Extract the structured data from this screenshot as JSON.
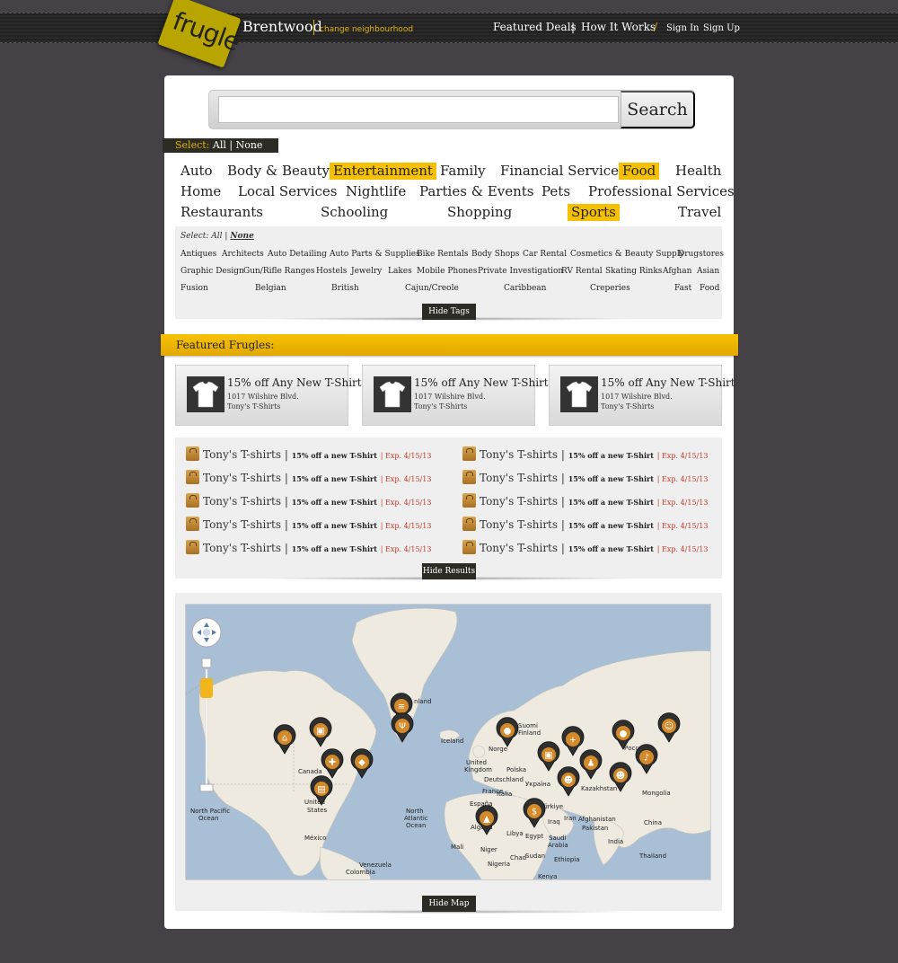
{
  "header": {
    "logo": "frugle",
    "location": "Brentwood",
    "change_link": "change neighbourhood",
    "nav": {
      "featured": "Featured Deals",
      "how": "How It Works",
      "signin": "Sign In",
      "signup": "Sign Up"
    },
    "sep1": "|",
    "sep2": "/"
  },
  "search": {
    "placeholder": "",
    "button": "Search"
  },
  "category_select": {
    "label": "Select:",
    "all": "All",
    "divider": "|",
    "none": "None"
  },
  "categories": [
    {
      "label": "Auto",
      "selected": false
    },
    {
      "label": "Body & Beauty",
      "selected": false
    },
    {
      "label": "Entertainment",
      "selected": true
    },
    {
      "label": "Family",
      "selected": false
    },
    {
      "label": "Financial Services",
      "selected": false
    },
    {
      "label": "Food",
      "selected": true
    },
    {
      "label": "Health",
      "selected": false
    },
    {
      "label": "Home",
      "selected": false
    },
    {
      "label": "Local Services",
      "selected": false
    },
    {
      "label": "Nightlife",
      "selected": false
    },
    {
      "label": "Parties & Events",
      "selected": false
    },
    {
      "label": "Pets",
      "selected": false
    },
    {
      "label": "Professional Services",
      "selected": false
    },
    {
      "label": "Restaurants",
      "selected": false
    },
    {
      "label": "Schooling",
      "selected": false
    },
    {
      "label": "Shopping",
      "selected": false
    },
    {
      "label": "Sports",
      "selected": true
    },
    {
      "label": "Travel",
      "selected": false
    }
  ],
  "tags": {
    "select_label": "Select:",
    "all": "All",
    "none": "None",
    "items": [
      "Antiques",
      "Architects",
      "Auto Detailing",
      "Auto Parts & Supplies",
      "Bike Rentals",
      "Body Shops",
      "Car Rental",
      "Cosmetics & Beauty Supply",
      "Drugstores",
      "Graphic Design",
      "Gun/Rifle Ranges",
      "Hostels",
      "Jewelry",
      "Lakes",
      "Mobile Phones",
      "Private Investigation",
      "RV Rental",
      "Skating Rinks",
      "Afghan",
      "Asian",
      "Fusion",
      "Belgian",
      "British",
      "Cajun/Creole",
      "Caribbean",
      "Creperies",
      "Fast",
      "Food"
    ],
    "hide_button": "Hide Tags"
  },
  "featured": {
    "title": "Featured Frugles:",
    "deals": [
      {
        "title": "15% off Any New T-Shirt",
        "address": "1017 Wilshire Blvd.",
        "merchant": "Tony's T-Shirts"
      },
      {
        "title": "15% off Any New T-Shirt",
        "address": "1017 Wilshire Blvd.",
        "merchant": "Tony's T-Shirts"
      },
      {
        "title": "15% off Any New T-Shirt",
        "address": "1017 Wilshire Blvd.",
        "merchant": "Tony's T-Shirts"
      }
    ]
  },
  "results": {
    "items": [
      {
        "merchant": "Tony's T-shirts",
        "offer": "15% off a new T-Shirt",
        "expires": "Exp. 4/15/13"
      },
      {
        "merchant": "Tony's T-shirts",
        "offer": "15% off a new T-Shirt",
        "expires": "Exp. 4/15/13"
      },
      {
        "merchant": "Tony's T-shirts",
        "offer": "15% off a new T-Shirt",
        "expires": "Exp. 4/15/13"
      },
      {
        "merchant": "Tony's T-shirts",
        "offer": "15% off a new T-Shirt",
        "expires": "Exp. 4/15/13"
      },
      {
        "merchant": "Tony's T-shirts",
        "offer": "15% off a new T-Shirt",
        "expires": "Exp. 4/15/13"
      },
      {
        "merchant": "Tony's T-shirts",
        "offer": "15% off a new T-Shirt",
        "expires": "Exp. 4/15/13"
      },
      {
        "merchant": "Tony's T-shirts",
        "offer": "15% off a new T-Shirt",
        "expires": "Exp. 4/15/13"
      },
      {
        "merchant": "Tony's T-shirts",
        "offer": "15% off a new T-Shirt",
        "expires": "Exp. 4/15/13"
      },
      {
        "merchant": "Tony's T-shirts",
        "offer": "15% off a new T-Shirt",
        "expires": "Exp. 4/15/13"
      },
      {
        "merchant": "Tony's T-shirts",
        "offer": "15% off a new T-Shirt",
        "expires": "Exp. 4/15/13"
      }
    ],
    "hide_button": "Hide Results"
  },
  "map": {
    "hide_button": "Hide Map",
    "labels": [
      "Canada",
      "United States",
      "México",
      "Venezuela",
      "Colombia",
      "Iceland",
      "North Atlantic Ocean",
      "North Pacific Ocean",
      "Suomi Finland",
      "Norge",
      "United Kingdom",
      "Polska",
      "Deutschland",
      "France",
      "España",
      "Italia",
      "Україна",
      "Россия",
      "Kazakhstan",
      "Mongolia",
      "China",
      "India",
      "Afghanistan",
      "Pakistan",
      "Iraq",
      "Iran",
      "Türkiye",
      "Egypt",
      "Libya",
      "Algeria",
      "Mali",
      "Niger",
      "Chad",
      "Sudan",
      "Nigeria",
      "Saudi Arabia",
      "Ethiopia",
      "Kenya",
      "Thailand",
      "Greenland"
    ],
    "pins": [
      "house-icon",
      "shopping-bag-icon",
      "gift-icon",
      "cake-icon",
      "briefcase-icon",
      "hamburger-icon",
      "restaurant-icon",
      "soccer-icon",
      "theater-icon",
      "first-aid-icon",
      "shopping-bag-icon",
      "person-icon",
      "people-icon",
      "music-icon",
      "pumpkin-icon",
      "people-icon",
      "car-icon",
      "money-icon"
    ]
  },
  "colors": {
    "accent": "#f5c000",
    "link_red": "#c0392b",
    "bg": "#454247"
  }
}
